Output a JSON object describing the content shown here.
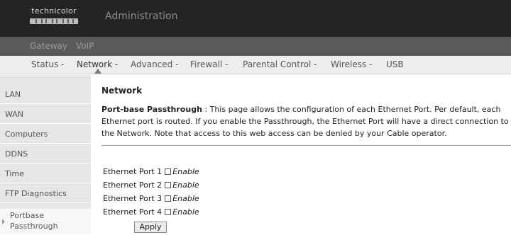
{
  "header": {
    "logo_text": "technicolor",
    "title": "Administration"
  },
  "nav_primary": [
    "Gateway",
    "VoIP"
  ],
  "nav_secondary": [
    "Status -",
    "Network -",
    "Advanced -",
    "Firewall -",
    "Parental Control -",
    "Wireless -",
    "USB"
  ],
  "nav_secondary_active": "Network -",
  "sidebar": {
    "items": [
      "LAN",
      "WAN",
      "Computers",
      "DDNS",
      "Time",
      "FTP Diagnostics"
    ],
    "active_line1": "Portbase",
    "active_line2": "Passthrough"
  },
  "main": {
    "title": "Network",
    "desc_term": "Port-base Passthrough",
    "desc_sep": " : ",
    "desc_body": "This page allows the configuration of each Ethernet Port. Per default, each Ethernet port is routed. If you enable the Passthrough, the Ethernet Port will have a direct connection to the Network. Note that access to this web access can be denied by your Cable operator.",
    "ports": [
      {
        "label": "Ethernet Port 1",
        "enable_label": "Enable",
        "checked": false
      },
      {
        "label": "Ethernet Port 2",
        "enable_label": "Enable",
        "checked": false
      },
      {
        "label": "Ethernet Port 3",
        "enable_label": "Enable",
        "checked": false
      },
      {
        "label": "Ethernet Port 4",
        "enable_label": "Enable",
        "checked": false
      }
    ],
    "apply_label": "Apply"
  }
}
